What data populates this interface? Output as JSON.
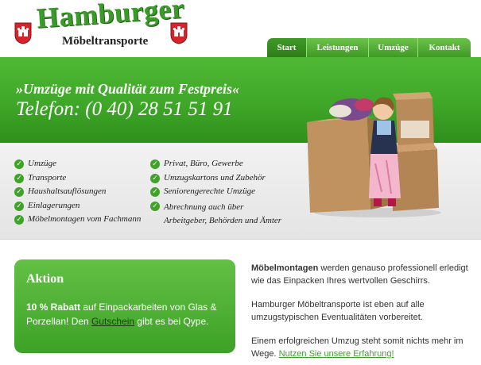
{
  "header": {
    "logo_title": "Hamburger",
    "logo_subtitle": "Möbeltransporte"
  },
  "nav": {
    "items": [
      {
        "label": "Start",
        "active": true
      },
      {
        "label": "Leistungen",
        "active": false
      },
      {
        "label": "Umzüge",
        "active": false
      },
      {
        "label": "Kontakt",
        "active": false
      }
    ]
  },
  "banner": {
    "tagline": "»Umzüge mit Qualität zum Festpreis«",
    "phone": "Telefon: (0 40) 28 51 51 91"
  },
  "features": {
    "col1": [
      "Umzüge",
      "Transporte",
      "Haushaltsauflösungen",
      "Einlagerungen",
      "Möbelmontagen vom Fachmann"
    ],
    "col2": [
      "Privat, Büro, Gewerbe",
      "Umzugskartons und Zubehör",
      "Seniorengerechte Umzüge",
      "Abrechnung auch über",
      "Arbeitgeber, Behörden und Ämter"
    ]
  },
  "aktion": {
    "title": "Aktion",
    "bold": "10 % Rabatt",
    "text1": " auf Einpackarbeiten von Glas & Porzellan! Den ",
    "link": "Gutschein",
    "text2": " gibt es bei Qype."
  },
  "content": {
    "p1_bold": "Möbelmontagen",
    "p1_text": " werden genauso professionell erledigt wie das Einpacken Ihres wertvollen Geschirrs.",
    "p2": "Hamburger Möbeltransporte ist eben auf alle umzugstypischen Eventualitäten vorbereitet.",
    "p3_text": "Einem erfolgreichen Umzug steht somit nichts mehr im Wege. ",
    "p3_link": "Nutzen Sie unsere Erfahrung!"
  },
  "colors": {
    "brand_green": "#3fa728",
    "crest_red": "#d7232b"
  },
  "icons": {
    "crest": "hamburg-crest-icon",
    "check": "check-circle-icon"
  }
}
